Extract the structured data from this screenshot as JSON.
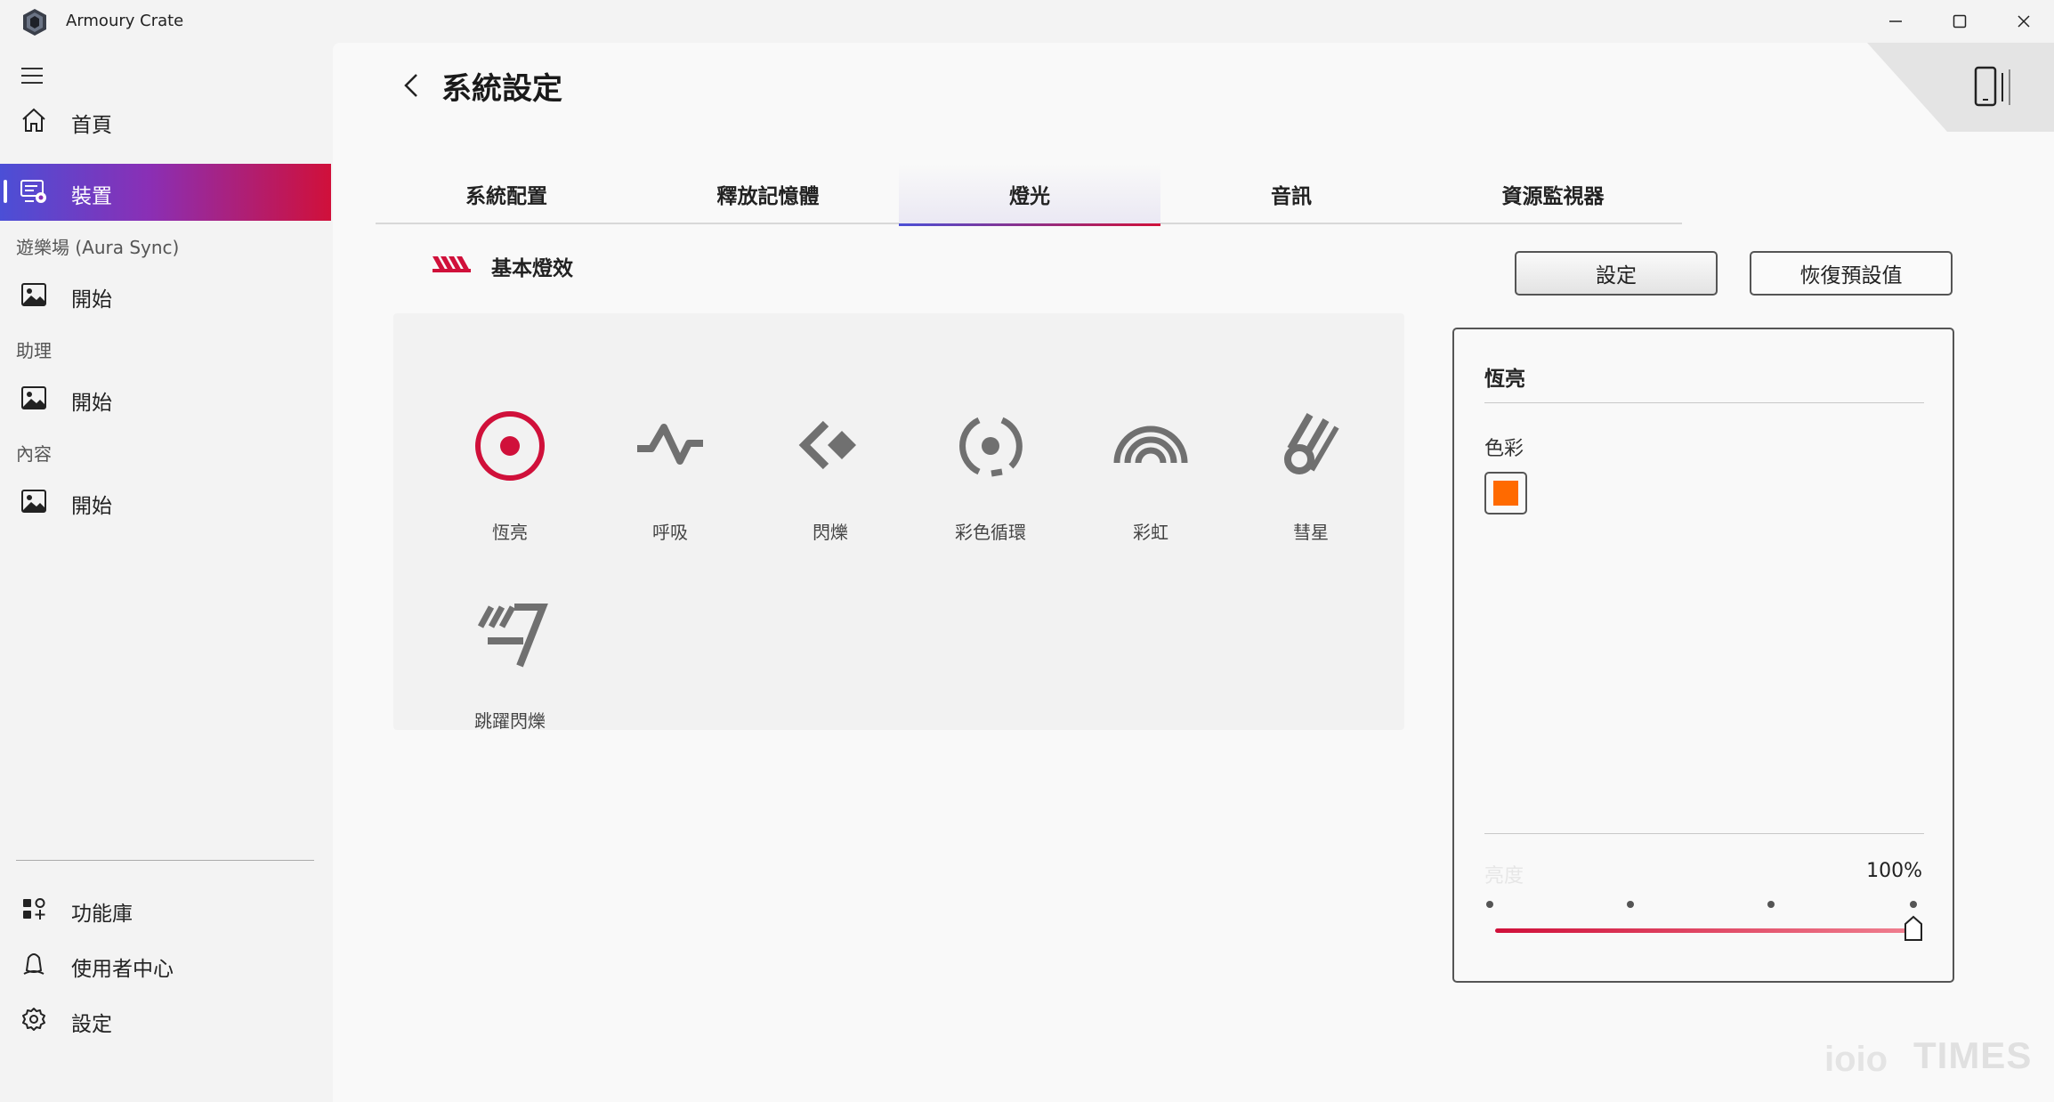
{
  "window": {
    "title": "Armoury Crate",
    "minimize_glyph": "─",
    "maximize_glyph": "☐",
    "close_glyph": "✕"
  },
  "sidebar": {
    "items": [
      {
        "label": "首頁",
        "icon": "home-icon"
      },
      {
        "label": "裝置",
        "icon": "device-icon",
        "active": true
      }
    ],
    "sections": [
      {
        "title": "遊樂場 (Aura Sync)",
        "item": {
          "label": "開始",
          "icon": "image-icon"
        }
      },
      {
        "title": "助理",
        "item": {
          "label": "開始",
          "icon": "image-icon"
        }
      },
      {
        "title": "內容",
        "item": {
          "label": "開始",
          "icon": "image-icon"
        }
      }
    ],
    "bottom_items": [
      {
        "label": "功能庫",
        "icon": "library-icon"
      },
      {
        "label": "使用者中心",
        "icon": "user-center-icon"
      },
      {
        "label": "設定",
        "icon": "gear-icon"
      }
    ]
  },
  "header": {
    "title": "系統設定"
  },
  "tabs": [
    {
      "label": "系統配置"
    },
    {
      "label": "釋放記憶體"
    },
    {
      "label": "燈光",
      "active": true
    },
    {
      "label": "音訊"
    },
    {
      "label": "資源監視器"
    }
  ],
  "lighting": {
    "section_title": "基本燈效",
    "setting_button": "設定",
    "reset_button": "恢復預設值",
    "effects": [
      {
        "label": "恆亮",
        "icon": "static-icon",
        "selected": true
      },
      {
        "label": "呼吸",
        "icon": "breathing-icon"
      },
      {
        "label": "閃爍",
        "icon": "strobing-icon"
      },
      {
        "label": "彩色循環",
        "icon": "color-cycle-icon"
      },
      {
        "label": "彩虹",
        "icon": "rainbow-icon"
      },
      {
        "label": "彗星",
        "icon": "comet-icon"
      },
      {
        "label": "跳躍閃爍",
        "icon": "flash-and-dash-icon"
      }
    ]
  },
  "detail": {
    "title": "恆亮",
    "color_label": "色彩",
    "color_value": "#ff6a00",
    "brightness_label": "亮度",
    "brightness_value": "100%",
    "brightness_level": 1.0
  },
  "colors": {
    "accent_red": "#d0103a",
    "accent_blue": "#4b4fd6",
    "icon_gray": "#707070"
  },
  "watermark": {
    "logo": "ioio",
    "text": "TIMES"
  }
}
